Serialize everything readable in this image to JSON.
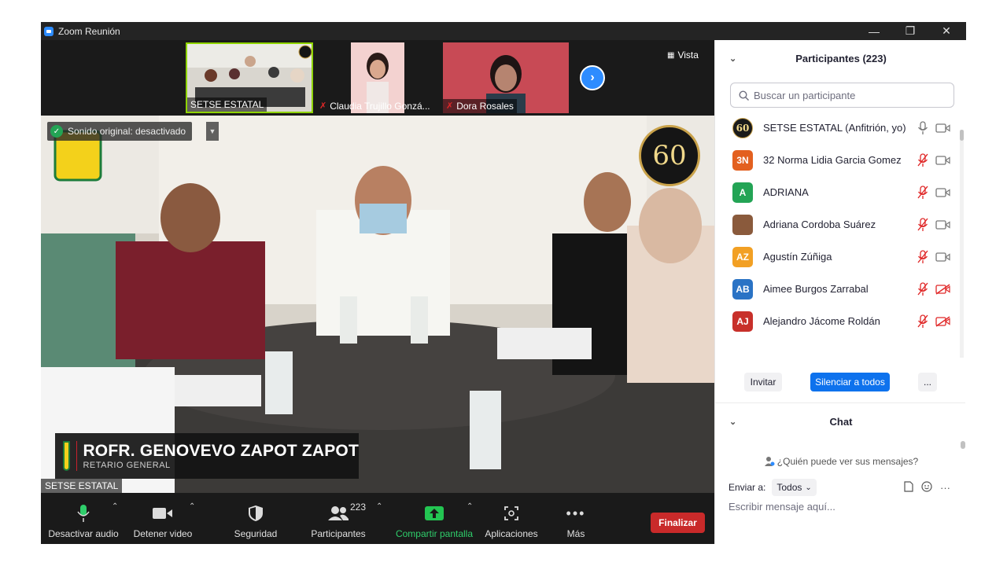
{
  "window": {
    "title": "Zoom Reunión"
  },
  "thumbnails": [
    {
      "name": "SETSE ESTATAL",
      "muted": false
    },
    {
      "name": "Claudia Trujillo Gonzá...",
      "muted": true
    },
    {
      "name": "Dora Rosales",
      "muted": true
    }
  ],
  "view_label": "Vista",
  "main_video": {
    "sound_status": "Sonido original: desactivado",
    "banner_name": "ROFR. GENOVEVO ZAPOT ZAPOT",
    "banner_role": "RETARIO GENERAL",
    "speaker_name": "SETSE ESTATAL",
    "logo_text": "60"
  },
  "toolbar": {
    "audio": "Desactivar audio",
    "video": "Detener video",
    "security": "Seguridad",
    "participants": "Participantes",
    "participant_count": "223",
    "share": "Compartir pantalla",
    "apps": "Aplicaciones",
    "more": "Más",
    "end": "Finalizar"
  },
  "participants_panel": {
    "title": "Participantes (223)",
    "search_placeholder": "Buscar un participante",
    "participants": [
      {
        "initials": "60",
        "name": "SETSE ESTATAL (Anfitrión, yo)",
        "color": "#1b1b1b",
        "mic": "on",
        "video": "on"
      },
      {
        "initials": "3N",
        "name": "32 Norma Lidia Garcia Gomez",
        "color": "#e3601f",
        "mic": "muted",
        "video": "on"
      },
      {
        "initials": "A",
        "name": "ADRIANA",
        "color": "#23a455",
        "mic": "muted",
        "video": "on"
      },
      {
        "initials": "",
        "name": "Adriana Cordoba Suárez",
        "color": "#8a5a3c",
        "mic": "muted",
        "video": "on"
      },
      {
        "initials": "AZ",
        "name": "Agustín Zúñiga",
        "color": "#f2a024",
        "mic": "muted",
        "video": "on"
      },
      {
        "initials": "AB",
        "name": "Aimee Burgos Zarrabal",
        "color": "#2a73c5",
        "mic": "muted",
        "video": "off"
      },
      {
        "initials": "AJ",
        "name": "Alejandro Jácome Roldán",
        "color": "#c8302a",
        "mic": "muted",
        "video": "off"
      }
    ],
    "invite": "Invitar",
    "mute_all": "Silenciar a todos",
    "more": "..."
  },
  "chat": {
    "title": "Chat",
    "who_can_see": "¿Quién puede ver sus mensajes?",
    "send_to_label": "Enviar a:",
    "send_to_value": "Todos",
    "message_placeholder": "Escribir mensaje aquí..."
  },
  "colors": {
    "accent": "#2d8cff",
    "end": "#c92a2a",
    "muted": "#e02828",
    "share": "#23c552"
  }
}
